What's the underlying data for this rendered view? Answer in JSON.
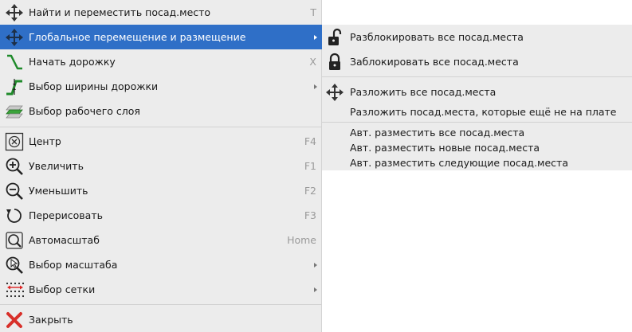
{
  "menu": {
    "items": [
      {
        "label": "Найти и переместить посад.место",
        "shortcut": "T",
        "icon": "move-icon"
      },
      {
        "label": "Глобальное перемещение и размещение",
        "icon": "move-icon",
        "submenu": true,
        "highlighted": true
      },
      {
        "label": "Начать дорожку",
        "shortcut": "X",
        "icon": "track-icon"
      },
      {
        "label": "Выбор ширины дорожки",
        "icon": "track-width-icon",
        "submenu": true
      },
      {
        "label": "Выбор рабочего слоя",
        "icon": "layers-icon"
      },
      {
        "label": "Центр",
        "shortcut": "F4",
        "icon": "zoom-center-icon"
      },
      {
        "label": "Увеличить",
        "shortcut": "F1",
        "icon": "zoom-in-icon"
      },
      {
        "label": "Уменьшить",
        "shortcut": "F2",
        "icon": "zoom-out-icon"
      },
      {
        "label": "Перерисовать",
        "shortcut": "F3",
        "icon": "redraw-icon"
      },
      {
        "label": "Автомасштаб",
        "shortcut": "Home",
        "icon": "zoom-fit-icon"
      },
      {
        "label": "Выбор масштаба",
        "icon": "zoom-select-icon",
        "submenu": true
      },
      {
        "label": "Выбор сетки",
        "icon": "grid-icon",
        "submenu": true
      },
      {
        "label": "Закрыть",
        "icon": "close-icon"
      }
    ]
  },
  "submenu": {
    "items": [
      {
        "label": "Разблокировать все посад.места",
        "icon": "unlock-icon"
      },
      {
        "label": "Заблокировать все посад.места",
        "icon": "lock-icon"
      },
      {
        "label": "Разложить все посад.места",
        "icon": "move-icon"
      },
      {
        "label": "Разложить посад.места, которые ещё не на плате"
      },
      {
        "label": "Авт. разместить все посад.места"
      },
      {
        "label": "Авт. разместить новые посад.места"
      },
      {
        "label": "Авт. разместить следующие посад.места"
      }
    ]
  },
  "colors": {
    "menu_background": "#ececec",
    "highlight": "#2f6fc7",
    "shortcut_text": "#9a9a9a",
    "separator": "#d2d2d2"
  }
}
